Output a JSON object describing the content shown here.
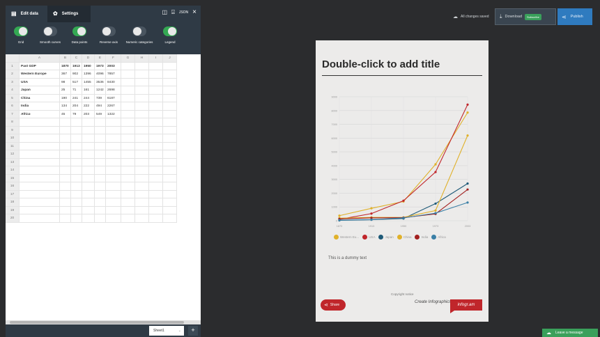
{
  "panel": {
    "tabs": [
      {
        "label": "Edit data",
        "icon": "table-icon"
      },
      {
        "label": "Settings",
        "icon": "gear-icon"
      }
    ],
    "window_buttons": [
      "layout-icon",
      "bell-icon",
      "json-icon",
      "close-icon"
    ],
    "json_label": "JSON",
    "close_glyph": "×"
  },
  "toggles": [
    {
      "label": "Grid",
      "on": true
    },
    {
      "label": "Smooth curves",
      "on": false
    },
    {
      "label": "Data points",
      "on": true
    },
    {
      "label": "Reverse axis",
      "on": false
    },
    {
      "label": "Numeric categories",
      "on": false
    },
    {
      "label": "Legend",
      "on": true
    }
  ],
  "sheet": {
    "columns": [
      "A",
      "B",
      "C",
      "D",
      "E",
      "F",
      "G",
      "H",
      "I",
      "J"
    ],
    "rows": [
      [
        "Past GDP",
        "1870",
        "1913",
        "1950",
        "1973",
        "2003",
        "",
        "",
        "",
        ""
      ],
      [
        "Western Europe",
        "367",
        "902",
        "1396",
        "4096",
        "7857",
        "",
        "",
        "",
        ""
      ],
      [
        "USA",
        "98",
        "517",
        "1455",
        "3536",
        "8430",
        "",
        "",
        "",
        ""
      ],
      [
        "Japan",
        "25",
        "71",
        "161",
        "1242",
        "2698",
        "",
        "",
        "",
        ""
      ],
      [
        "China",
        "190",
        "241",
        "244",
        "739",
        "6187",
        "",
        "",
        "",
        ""
      ],
      [
        "India",
        "134",
        "204",
        "222",
        "494",
        "2267",
        "",
        "",
        "",
        ""
      ],
      [
        "Africa",
        "45",
        "79",
        "203",
        "549",
        "1322",
        "",
        "",
        "",
        ""
      ]
    ],
    "row_count": 20,
    "tab_label": "Sheet1",
    "caret": "⌄",
    "add_glyph": "+"
  },
  "topbar": {
    "saved_text": "All changes saved",
    "download_label": "Download",
    "download_badge": "Subscribe",
    "publish_label": "Publish"
  },
  "infographic": {
    "title": "Double-click to add title",
    "body_text": "This is a dummy text",
    "copyright": "Copyright notice",
    "credit": "Create Infographics",
    "share_label": "Share",
    "brand_label": "infogr.am"
  },
  "chart_data": {
    "type": "line",
    "x": [
      "1870",
      "1913",
      "1950",
      "1973",
      "2003"
    ],
    "ylim": [
      0,
      9000
    ],
    "yticks": [
      "0",
      "1000",
      "2000",
      "3000",
      "4000",
      "5000",
      "6000",
      "7000",
      "8000",
      "9000"
    ],
    "grid": true,
    "legend_position": "bottom",
    "series": [
      {
        "name": "Western Eu...",
        "color": "#e0b12a",
        "values": [
          367,
          902,
          1396,
          4096,
          7857
        ]
      },
      {
        "name": "USA",
        "color": "#c0262b",
        "values": [
          98,
          517,
          1455,
          3536,
          8430
        ]
      },
      {
        "name": "Japan",
        "color": "#1e5a78",
        "values": [
          25,
          71,
          161,
          1242,
          2698
        ]
      },
      {
        "name": "China",
        "color": "#e0b12a",
        "values": [
          190,
          241,
          244,
          739,
          6187
        ]
      },
      {
        "name": "India",
        "color": "#a2201f",
        "values": [
          134,
          204,
          222,
          494,
          2267
        ]
      },
      {
        "name": "Africa",
        "color": "#3a7fa6",
        "values": [
          45,
          79,
          203,
          549,
          1322
        ]
      }
    ]
  },
  "footer": {
    "message_label": "Leave a message"
  }
}
